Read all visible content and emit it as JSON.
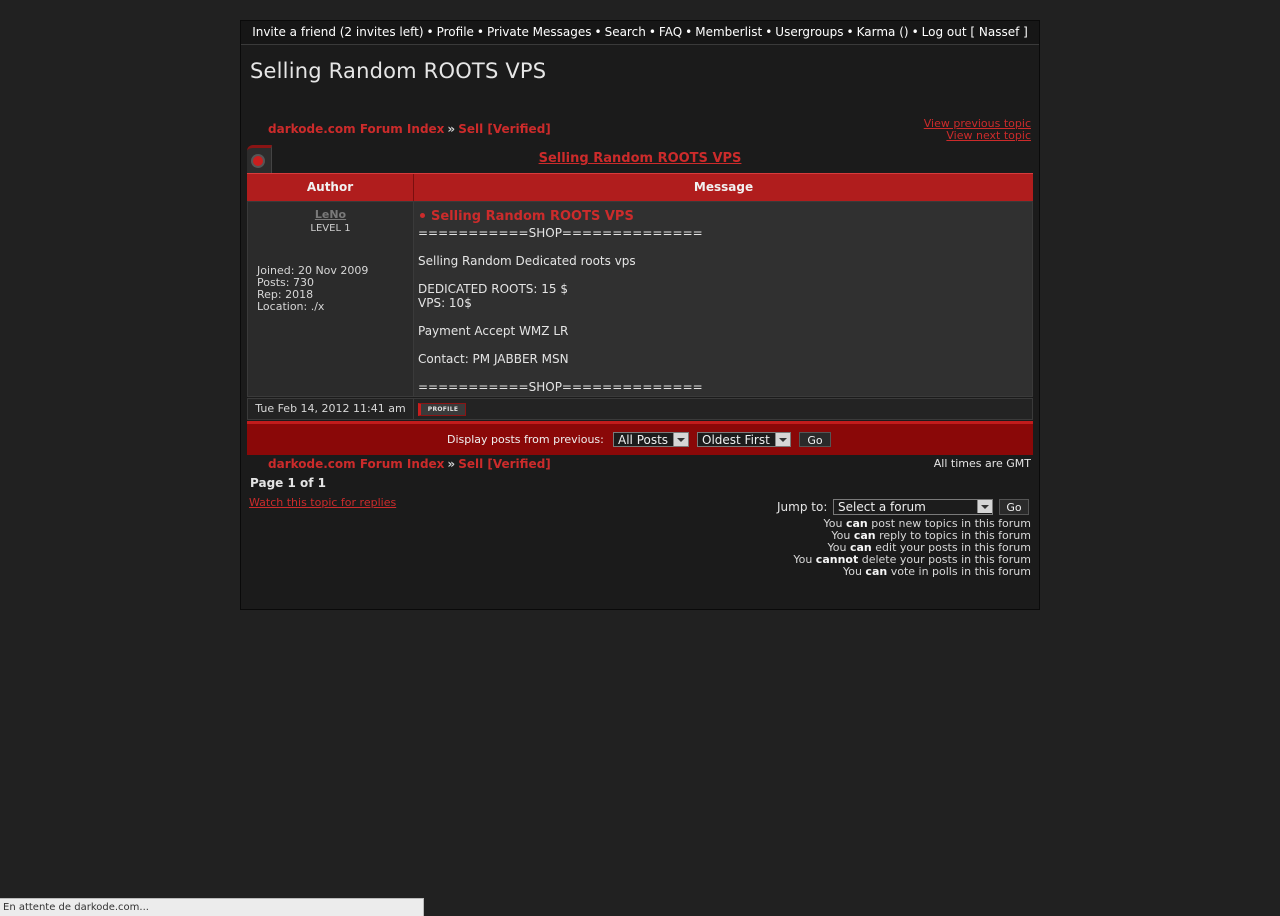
{
  "topnav": {
    "items": [
      "Invite a friend (2 invites left)",
      "Profile",
      "Private Messages",
      "Search",
      "FAQ",
      "Memberlist",
      "Usergroups",
      "Karma ()",
      "Log out [ Nassef ]"
    ],
    "separator": "•"
  },
  "page_title": "Selling Random ROOTS VPS",
  "breadcrumb": {
    "index": "darkode.com Forum Index",
    "sep": "»",
    "forum": "Sell [Verified]"
  },
  "nav": {
    "prev": "View previous topic",
    "next": "View next topic"
  },
  "topic_link": "Selling Random ROOTS VPS",
  "table": {
    "author_header": "Author",
    "message_header": "Message"
  },
  "post": {
    "author": "LeNo",
    "level": "LEVEL 1",
    "joined": "Joined: 20 Nov 2009",
    "posts": "Posts: 730",
    "rep": "Rep: 2018",
    "location": "Location: ./x",
    "subject": "Selling Random ROOTS VPS",
    "body": "===========SHOP==============\n\nSelling Random Dedicated roots vps\n\nDEDICATED ROOTS: 15 $\nVPS: 10$\n\nPayment Accept WMZ LR\n\nContact: PM JABBER MSN\n\n===========SHOP==============",
    "date": "Tue Feb 14, 2012 11:41 am",
    "profile_btn": "PROFILE"
  },
  "filter": {
    "label": "Display posts from previous:",
    "range_value": "All Posts",
    "order_value": "Oldest First",
    "go": "Go"
  },
  "footer": {
    "timezone": "All times are GMT",
    "page": "Page 1 of 1",
    "watch": "Watch this topic for replies",
    "jump_label": "Jump to:",
    "jump_value": "Select a forum",
    "jump_go": "Go"
  },
  "permissions": [
    {
      "pre": "You ",
      "verb": "can",
      "post": " post new topics in this forum"
    },
    {
      "pre": "You ",
      "verb": "can",
      "post": " reply to topics in this forum"
    },
    {
      "pre": "You ",
      "verb": "can",
      "post": " edit your posts in this forum"
    },
    {
      "pre": "You ",
      "verb": "cannot",
      "post": " delete your posts in this forum"
    },
    {
      "pre": "You ",
      "verb": "can",
      "post": " vote in polls in this forum"
    }
  ],
  "statusbar": "En attente de darkode.com..."
}
